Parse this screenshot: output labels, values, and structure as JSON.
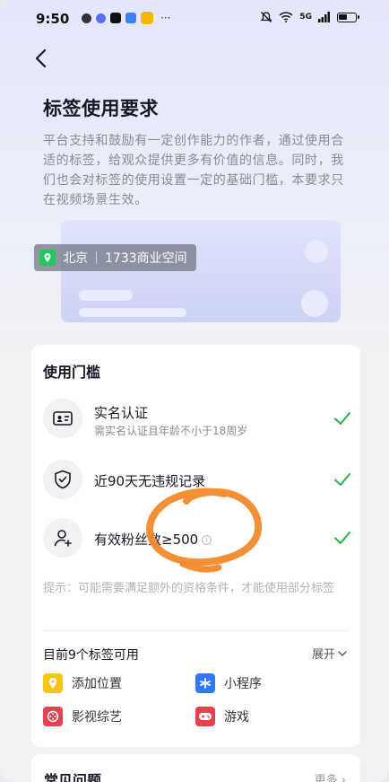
{
  "status_bar": {
    "time": "9:50",
    "more": "···",
    "signal_text": "5G"
  },
  "header": {
    "back_icon": "chevron-left-icon"
  },
  "page": {
    "title": "标签使用要求",
    "description": "平台支持和鼓励有一定创作能力的作者，通过使用合适的标签，给观众提供更多有价值的信息。同时，我们也会对标签的使用设置一定的基础门槛，本要求只在视频场景生效。"
  },
  "preview": {
    "location_city": "北京",
    "location_place": "1733商业空间"
  },
  "threshold": {
    "title": "使用门槛",
    "items": [
      {
        "title": "实名认证",
        "subtitle": "需实名认证且年龄不小于18周岁",
        "icon": "id-card-icon",
        "met": true
      },
      {
        "title": "近90天无违规记录",
        "icon": "shield-check-icon",
        "met": true
      },
      {
        "title": "有效粉丝数≥500",
        "icon": "user-add-icon",
        "info_icon": "info-icon",
        "met": true
      }
    ],
    "hint": "提示：可能需要满足额外的资格条件，才能使用部分标签"
  },
  "available": {
    "title": "目前9个标签可用",
    "expand_label": "展开",
    "tags": [
      {
        "label": "添加位置",
        "color": "#f5c518"
      },
      {
        "label": "小程序",
        "color": "#2f7bf5"
      },
      {
        "label": "影视综艺",
        "color": "#e8414f"
      },
      {
        "label": "游戏",
        "color": "#e8414f"
      }
    ]
  },
  "faq": {
    "title": "常见问题",
    "more_label": "更多"
  },
  "colors": {
    "accent_check": "#25b24a",
    "annotation": "#f28a2a"
  }
}
